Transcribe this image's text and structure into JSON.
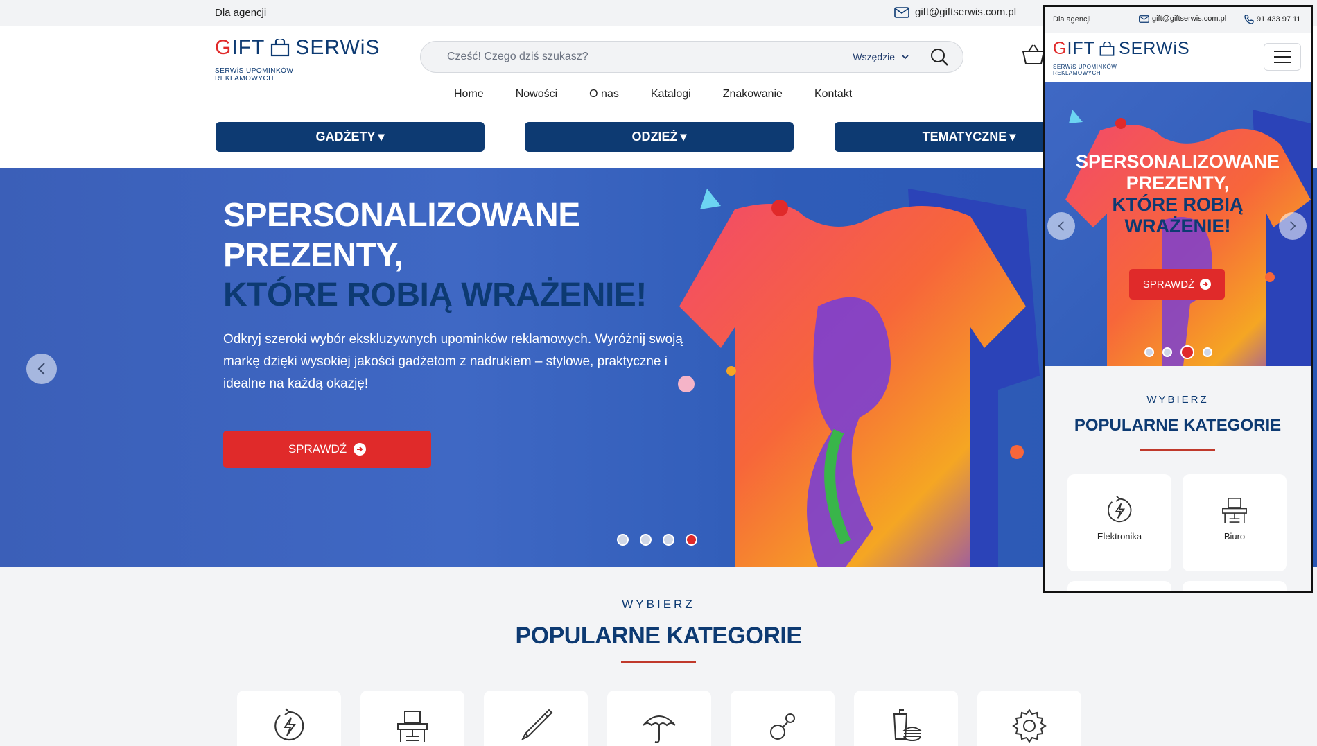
{
  "colors": {
    "navy": "#0d3a72",
    "red": "#e02a2a",
    "hero_blue": "#3f68c4"
  },
  "topbar": {
    "agency": "Dla agencji",
    "email": "gift@giftserwis.com.pl",
    "phone": "91 433 97 11"
  },
  "logo": {
    "word_g": "G",
    "word_rest": "IFT",
    "word_serwis": "SERWiS",
    "tagline": "SERWiS UPOMINKÓW REKLAMOWYCH"
  },
  "search": {
    "placeholder": "Cześć!  Czego dziś szukasz?",
    "scope": "Wszędzie"
  },
  "nav": [
    "Home",
    "Nowości",
    "O nas",
    "Katalogi",
    "Znakowanie",
    "Kontakt"
  ],
  "categories_menu": [
    "GADŻETY",
    "ODZIEŻ",
    "TEMATYCZNE"
  ],
  "hero": {
    "headline_line1": "SPERSONALIZOWANE",
    "headline_line2": "PREZENTY,",
    "headline_accent": "KTÓRE ROBIĄ WRAŻENIE!",
    "lead": "Odkryj szeroki wybór ekskluzywnych upominków reklamowych. Wyróżnij swoją markę dzięki wysokiej jakości gadżetom z nadrukiem – stylowe, praktyczne i idealne na każdą okazję!",
    "cta": "SPRAWDŹ",
    "slides_total": 4,
    "active_slide": 4
  },
  "popular": {
    "pre": "WYBIERZ",
    "title": "POPULARNE KATEGORIE",
    "cards": [
      {
        "icon": "electronics-icon"
      },
      {
        "icon": "office-desk-icon"
      },
      {
        "icon": "pen-icon"
      },
      {
        "icon": "umbrella-icon"
      },
      {
        "icon": "keychain-icon"
      },
      {
        "icon": "food-drink-icon"
      },
      {
        "icon": "gear-icon"
      }
    ]
  },
  "mobile": {
    "agency": "Dla agencji",
    "email": "gift@giftserwis.com.pl",
    "phone": "91 433 97 11",
    "headline_line1": "SPERSONALIZOWANE",
    "headline_line2": "PREZENTY,",
    "headline_accent_1": "KTÓRE ROBIĄ",
    "headline_accent_2": "WRAŻENIE!",
    "cta": "SPRAWDŹ",
    "active_slide": 3,
    "pre": "WYBIERZ",
    "title": "POPULARNE KATEGORIE",
    "cards": [
      {
        "label": "Elektronika",
        "icon": "electronics-icon"
      },
      {
        "label": "Biuro",
        "icon": "office-desk-icon"
      }
    ]
  }
}
